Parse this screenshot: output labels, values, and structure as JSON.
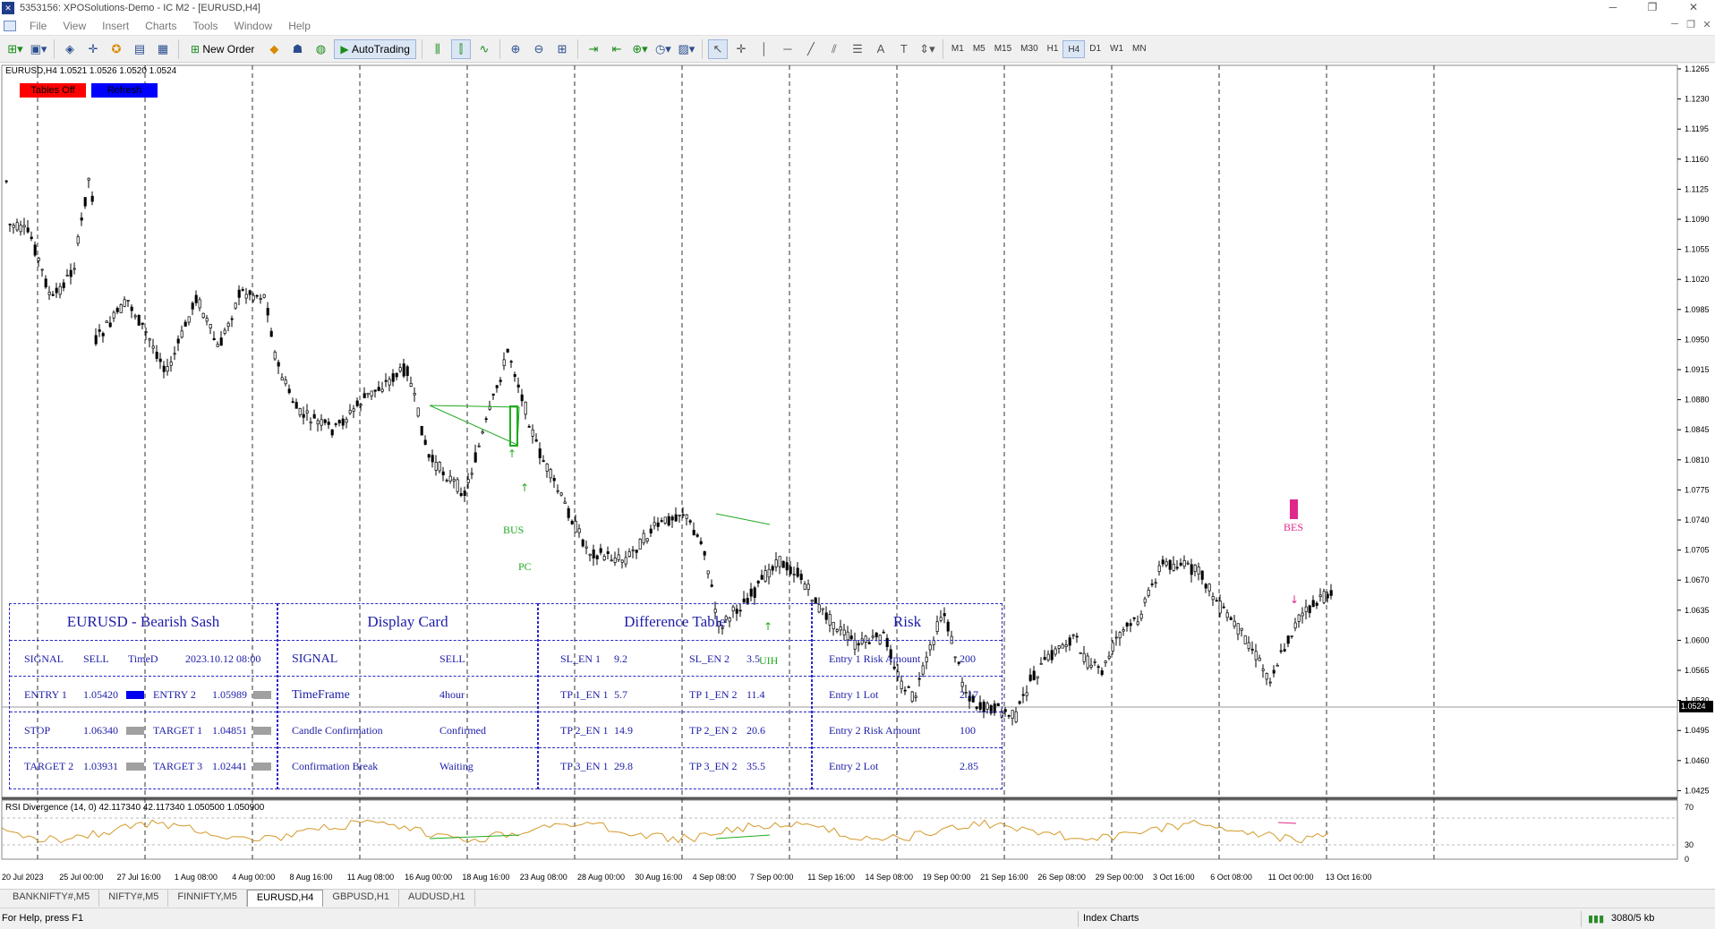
{
  "window": {
    "title": "5353156: XPOSolutions-Demo - IC M2 - [EURUSD,H4]"
  },
  "menu": [
    "File",
    "View",
    "Insert",
    "Charts",
    "Tools",
    "Window",
    "Help"
  ],
  "toolbar": {
    "new_order": "New Order",
    "auto_trading": "AutoTrading",
    "timeframes": [
      "M1",
      "M5",
      "M15",
      "M30",
      "H1",
      "H4",
      "D1",
      "W1",
      "MN"
    ],
    "active_timeframe": "H4",
    "notification_count": "1"
  },
  "chart": {
    "header": "EURUSD,H4  1.0521 1.0526 1.0520 1.0524",
    "buttons": {
      "tables_off": "Tables Off",
      "refresh": "Refresh"
    },
    "current_price": "1.0524",
    "price_ticks": [
      "1.1265",
      "1.1230",
      "1.1195",
      "1.1160",
      "1.1125",
      "1.1090",
      "1.1055",
      "1.1020",
      "1.0985",
      "1.0950",
      "1.0915",
      "1.0880",
      "1.0845",
      "1.0810",
      "1.0775",
      "1.0740",
      "1.0705",
      "1.0670",
      "1.0635",
      "1.0600",
      "1.0565",
      "1.0530",
      "1.0495",
      "1.0460",
      "1.0425"
    ],
    "time_labels": [
      "20 Jul 2023",
      "25 Jul 00:00",
      "27 Jul 16:00",
      "1 Aug 08:00",
      "4 Aug 00:00",
      "8 Aug 16:00",
      "11 Aug 08:00",
      "16 Aug 00:00",
      "18 Aug 16:00",
      "23 Aug 08:00",
      "28 Aug 00:00",
      "30 Aug 16:00",
      "4 Sep 08:00",
      "7 Sep 00:00",
      "11 Sep 16:00",
      "14 Sep 08:00",
      "19 Sep 00:00",
      "21 Sep 16:00",
      "26 Sep 08:00",
      "29 Sep 00:00",
      "3 Oct 16:00",
      "6 Oct 08:00",
      "11 Oct 00:00",
      "13 Oct 16:00"
    ],
    "annotations": {
      "bus": "BUS",
      "pc": "PC",
      "bes": "BES",
      "uih": "UIH"
    },
    "colors": {
      "bullish_annotation": "#22aa22",
      "bearish_annotation": "#e0288a",
      "candle": "#000000",
      "rsi_line": "#d49a2a"
    },
    "rsi": {
      "label": "RSI Divergence (14, 0) 42.117340 42.117340 1.050500 1.050900",
      "ticks": [
        "70",
        "30",
        "0"
      ]
    }
  },
  "dashboard": {
    "card1": {
      "title": "EURUSD - Bearish Sash",
      "signal_label": "SIGNAL",
      "signal_value": "SELL",
      "time_label": "TimeD",
      "time_value": "2023.10.12 08:00",
      "entry1_label": "ENTRY 1",
      "entry1_value": "1.05420",
      "entry2_label": "ENTRY 2",
      "entry2_value": "1.05989",
      "stop_label": "STOP",
      "stop_value": "1.06340",
      "target1_label": "TARGET 1",
      "target1_value": "1.04851",
      "target2_label": "TARGET 2",
      "target2_value": "1.03931",
      "target3_label": "TARGET 3",
      "target3_value": "1.02441"
    },
    "card2": {
      "title": "Display Card",
      "rows": [
        {
          "label": "SIGNAL",
          "value": "SELL"
        },
        {
          "label": "TimeFrame",
          "value": "4hour"
        },
        {
          "label": "Candle Confirmation",
          "value": "Confirmed"
        },
        {
          "label": "Confirmation Break",
          "value": "Waiting"
        }
      ]
    },
    "card3": {
      "title": "Difference Table",
      "rows": [
        {
          "l1": "SL_EN 1",
          "v1": "9.2",
          "l2": "SL_EN 2",
          "v2": "3.5"
        },
        {
          "l1": "TP 1_EN 1",
          "v1": "5.7",
          "l2": "TP 1_EN 2",
          "v2": "11.4"
        },
        {
          "l1": "TP 2_EN 1",
          "v1": "14.9",
          "l2": "TP 2_EN 2",
          "v2": "20.6"
        },
        {
          "l1": "TP 3_EN 1",
          "v1": "29.8",
          "l2": "TP 3_EN 2",
          "v2": "35.5"
        }
      ]
    },
    "card4": {
      "title": "Risk",
      "rows": [
        {
          "label": "Entry 1 Risk Amount",
          "value": "200"
        },
        {
          "label": "Entry 1 Lot",
          "value": "2.17"
        },
        {
          "label": "Entry 2 Risk Amount",
          "value": "100"
        },
        {
          "label": "Entry 2 Lot",
          "value": "2.85"
        }
      ]
    }
  },
  "tabs": [
    "BANKNIFTY#,M5",
    "NIFTY#,M5",
    "FINNIFTY,M5",
    "EURUSD,H4",
    "GBPUSD,H1",
    "AUDUSD,H1"
  ],
  "active_tab": "EURUSD,H4",
  "status": {
    "help": "For Help, press F1",
    "profile": "Index Charts",
    "traffic": "3080/5 kb"
  }
}
